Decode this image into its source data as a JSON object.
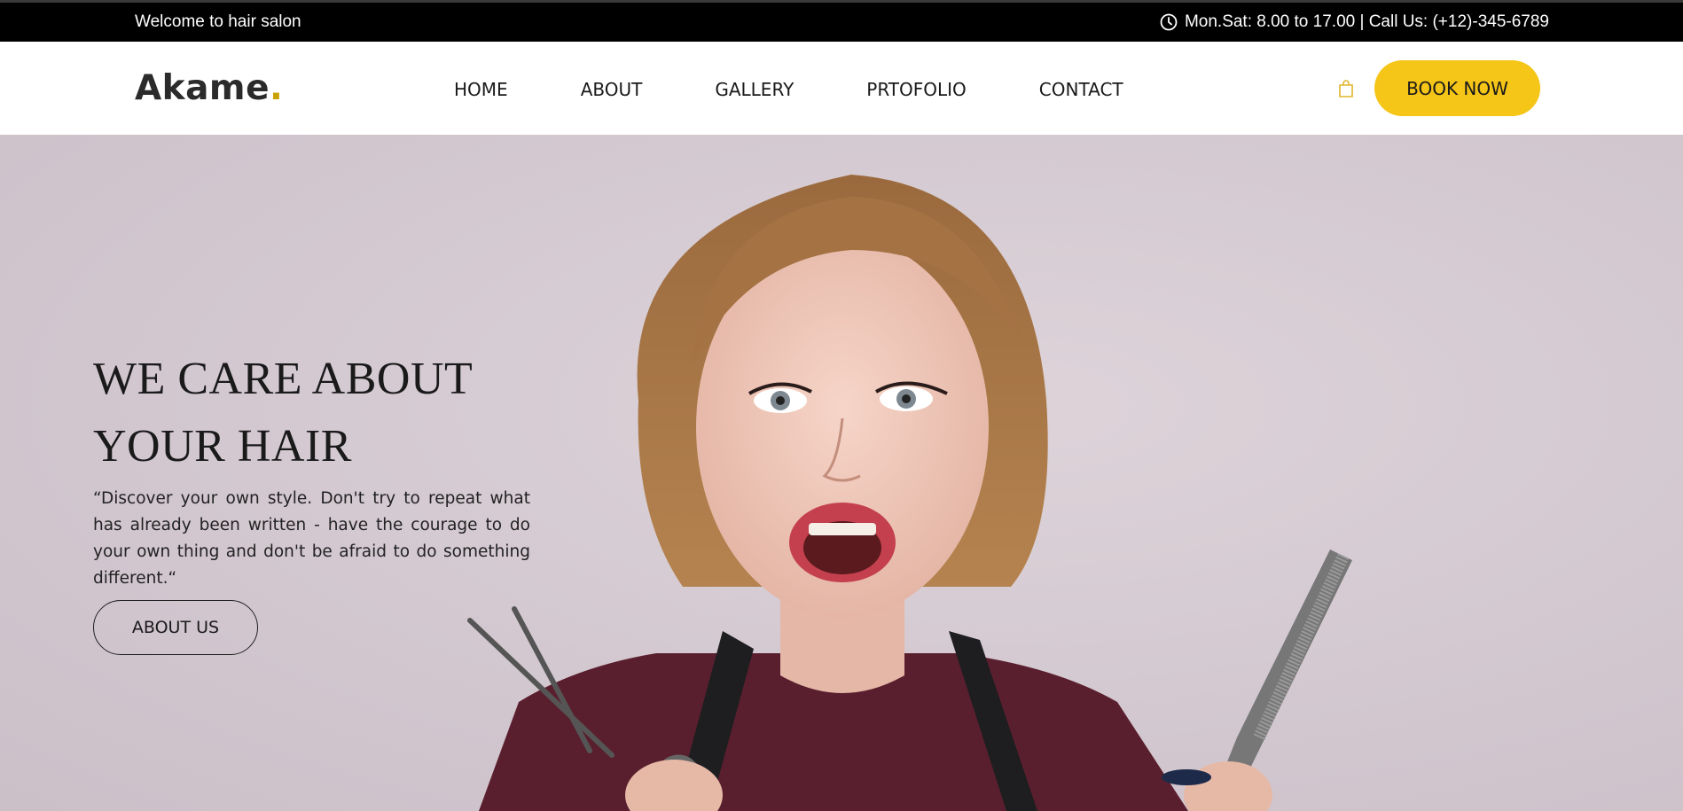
{
  "topbar": {
    "welcome": "Welcome to hair salon",
    "hours": "Mon.Sat: 8.00 to 17.00 | Call Us: (+12)-345-6789",
    "icon": "clock-icon"
  },
  "navbar": {
    "logo_text": "Akame",
    "logo_dot": ".",
    "items": [
      {
        "label": "HOME"
      },
      {
        "label": "ABOUT"
      },
      {
        "label": "GALLERY"
      },
      {
        "label": "PRTOFOLIO"
      },
      {
        "label": "CONTACT"
      }
    ],
    "cart_icon": "shopping-bag-icon",
    "book_label": "BOOK NOW"
  },
  "hero": {
    "title_line1": "WE CARE ABOUT",
    "title_line2": "YOUR HAIR",
    "text": "“Discover your own style. Don't try to repeat what has already been written - have the courage to do your own thing and don't be afraid to do something different.“",
    "button_label": "ABOUT US"
  },
  "colors": {
    "accent": "#f5c518",
    "logo_dot": "#c9a200",
    "topbar_bg": "#000000",
    "hero_bg": "#d6cbd2"
  }
}
